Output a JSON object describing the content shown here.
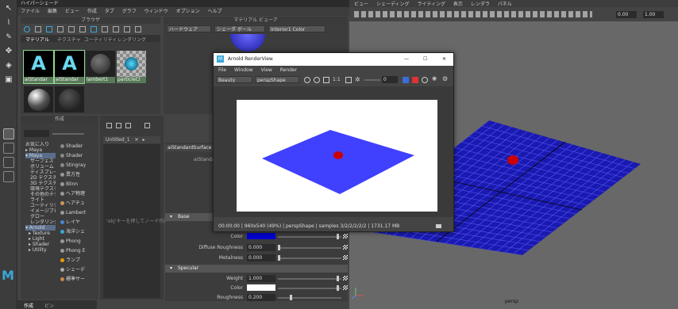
{
  "hypershade": {
    "title": "ハイパーシェード",
    "menu": [
      "ファイル",
      "編集",
      "ビュー",
      "作成",
      "タブ",
      "グラフ",
      "ウィンドウ",
      "オプション",
      "ヘルプ"
    ],
    "browser_label": "ブラウザ",
    "browser_tabs": [
      "マテリアル",
      "テクスチャ",
      "ユーティリティ",
      "レンダリング"
    ],
    "swatches": [
      "aiStandar",
      "aiStandar",
      "lambert1",
      "particleCl"
    ],
    "create_label": "作成",
    "create_tree": [
      "お気に入り",
      "▸ Maya",
      "▾ Maya",
      "サーフェス",
      "ボリューム",
      "ディスプレイ",
      "2D テクスチャ",
      "3D テクスチャ",
      "環境テクスチャ",
      "その他のテクスチャ",
      "ライト",
      "ユーティリティ",
      "イメージプレーン",
      "グロー",
      "レンダリング",
      "▾ Arnold",
      "▸ Texture",
      "▸ Light",
      "▸ Shader",
      "▸ Utility"
    ],
    "create_list": [
      "Shader",
      "Shader",
      "Stingray",
      "異方性",
      "Blinn",
      "ヘア物理",
      "ヘアチュ",
      "Lambert",
      "レイヤ",
      "海洋シェ",
      "Phong",
      "Phong E",
      "ランプ",
      "シェーデ",
      "標準サー"
    ],
    "graph_tab": "Untitled_1",
    "graph_hint": "'obj'キーを押してノード作成",
    "bottom_tabs": [
      "作成",
      "ビン"
    ],
    "editor_label": "マテリアル ビューア",
    "editor_renderer": "ハードウェア",
    "editor_shape": "シェーダ ボール",
    "editor_env": "Interior1 Color",
    "attr_tab": "aiStandardSurface",
    "attr_name": "aiStandardSur",
    "sections": {
      "base": "Base",
      "specular": "Specular"
    },
    "attrs": {
      "color_label": "Color",
      "diffuse_roughness_label": "Diffuse Roughness",
      "diffuse_roughness": "0.000",
      "metalness_label": "Metalness",
      "metalness": "0.000",
      "weight_label": "Weight",
      "weight": "1.000",
      "spec_color_label": "Color",
      "roughness_label": "Roughness",
      "roughness": "0.200",
      "base_letter": "V"
    }
  },
  "viewport": {
    "menu": [
      "ビュー",
      "シェーディング",
      "ライティング",
      "表示",
      "レンダラ",
      "パネル"
    ],
    "field1": "0.00",
    "field2": "1.00",
    "camera_label": "persp"
  },
  "renderview": {
    "title": "Arnold RenderView",
    "window_controls": [
      "—",
      "☐",
      "✕"
    ],
    "menu": [
      "File",
      "Window",
      "View",
      "Render"
    ],
    "aov": "Beauty",
    "camera": "perspShape",
    "ratio": "1:1",
    "exposure": "0",
    "status": "00:00:00 | 960x540 (49%) | perspShape | samples 3/2/2/2/2/2 | 1731.17 MB"
  },
  "colors": {
    "plane_blue": "#4040ff",
    "sphere_red": "#cc0000",
    "grid_blue": "#1a1ab0",
    "attr_color": "#0000cc",
    "maya_accent": "#3aa8d8"
  }
}
